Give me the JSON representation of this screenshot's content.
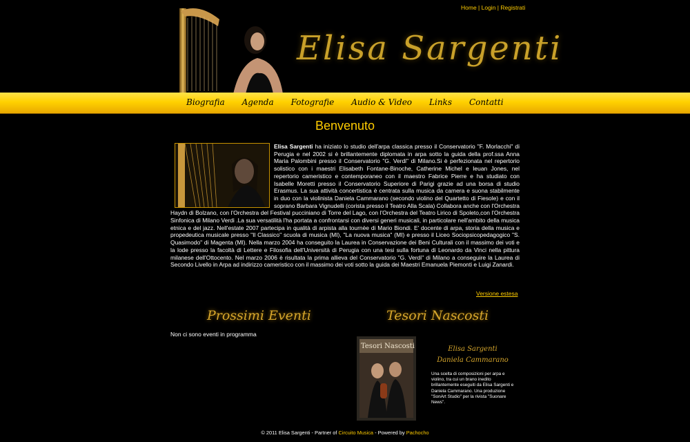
{
  "top_links": {
    "home": "Home",
    "login": "Login",
    "register": "Registrati",
    "sep": " | "
  },
  "signature": "Elisa Sargenti",
  "nav": [
    "Biografia",
    "Agenda",
    "Fotografie",
    "Audio & Video",
    "Links",
    "Contatti"
  ],
  "welcome_title": "Benvenuto",
  "bio": {
    "name": "Elisa Sargenti",
    "text": " ha iniziato lo studio dell'arpa classica presso il Conservatorio \"F. Morlacchi\" di Perugia e nel 2002 si è brillantemente diplomata in arpa sotto la guida della prof.ssa Anna Maria Palombini presso il Conservatorio \"G. Verdi\" di Milano.Si è perfezionata nel repertorio solistico con i maestri Elisabeth Fontane-Binoche, Catherine Michel e Ieuan Jones, nel repertorio cameristico e contemporaneo con il maestro Fabrice Pierre e ha studiato con Isabelle Moretti presso il Conservatorio Superiore di Parigi grazie ad una borsa di studio Erasmus. La sua attività concertistica è centrata sulla musica da camera e suona stabilmente in duo con la violinista Daniela Cammarano (secondo violino del Quartetto di Fiesole) e con il soprano Barbara Vignudelli (corista presso il Teatro Alla Scala) Collabora anche con l'Orchestra Haydn di Bolzano, con l'Orchestra del Festival pucciniano di Torre del Lago, con l'Orchestra del Teatro Lirico di Spoleto,con l'Orchestra Sinfonica di Milano Verdi .La sua versatilità l'ha portata a confrontarsi con diversi generi musicali, in particolare nell'ambito della musica etnica e del jazz. Nell'estate 2007 partecipa in qualità di arpista alla tournèe di Mario Biondi. E' docente di arpa, storia della musica e propedeutica musicale presso \"Il Classico\" scuola di musica (MI), \"La nuova musica\" (MI) e presso il Liceo Sociopsicopedagogico \"S. Quasimodo\" di Magenta (MI). Nella marzo 2004 ha conseguito la Laurea in Conservazione dei Beni Culturali con il massimo dei voti e la lode presso la facoltà di Lettere e Filosofia dell'Università di Perugia con una tesi sulla fortuna di Leonardo da Vinci nella pittura milanese dell'Ottocento. Nel marzo 2006 è risultata la prima allieva del Conservatorio \"G. Verdi\" di Milano a conseguire la Laurea di Secondo Livello in Arpa ad indirizzo cameristico con il massimo dei voti sotto la guida dei Maestri Emanuela Piemonti e Luigi Zanardi."
  },
  "more_link": "Versione estesa",
  "events": {
    "title": "Prossimi Eventi",
    "empty": "Non ci sono eventi in programma"
  },
  "tesori": {
    "title": "Tesori Nascosti",
    "cd_cover_title": "Tesori Nascosti",
    "artist1": "Elisa Sargenti",
    "artist2": "Daniela Cammarano",
    "desc": "Una scelta di composizioni per arpa e violino, tra cui un brano inedito brillantemente eseguiti da Elisa Sargenti e Daniela Cammarano. Una produzione \"SonArt Studio\" per la rivista \"Suonare News\"."
  },
  "footer": {
    "prefix": "© 2011 Elisa Sargenti - Partner of ",
    "partner": "Circuito Musica",
    "mid": " - Powered by ",
    "powered": "Pachocho"
  },
  "colors": {
    "accent": "#ffcc00",
    "gold": "#d6a62c",
    "nav_bar": "#ffd100",
    "bg": "#000000"
  }
}
